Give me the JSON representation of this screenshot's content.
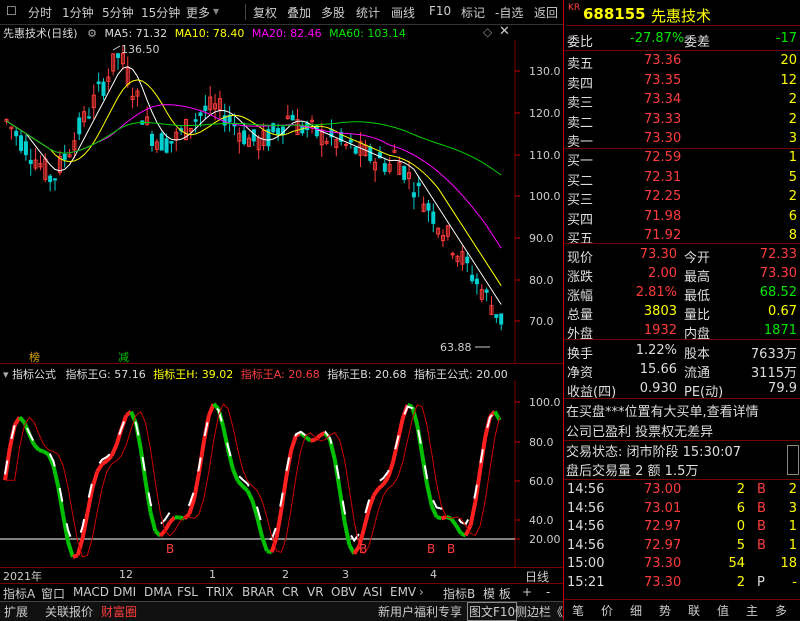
{
  "toolbar": {
    "items": [
      "分时",
      "1分钟",
      "5分钟",
      "15分钟",
      "更多",
      "复权",
      "叠加",
      "多股",
      "统计",
      "画线",
      "F10",
      "标记",
      "-自选",
      "返回"
    ]
  },
  "stock": {
    "market_badge": "KR",
    "code": "688155",
    "name": "先惠技术"
  },
  "main_chart": {
    "title": "先惠技术(日线)",
    "ma5": "MA5: 71.32",
    "ma10": "MA10: 78.40",
    "ma20": "MA20: 82.46",
    "ma60": "MA60: 103.14",
    "high_label": "136.50",
    "low_label": "63.88",
    "y_ticks": [
      "130.0",
      "120.0",
      "110.0",
      "100.0",
      "90.0",
      "80.0",
      "70.0"
    ],
    "tag_bang": "榜",
    "tag_jian": "减",
    "colors": {
      "up": "#ff3c3c",
      "down": "#00d0d0",
      "ma5": "#ffffff",
      "ma10": "#ffff00",
      "ma20": "#ff00ff",
      "ma60": "#00d000"
    }
  },
  "indicator": {
    "title": "指标公式",
    "g": "指标王G: 57.16",
    "h": "指标王H: 39.02",
    "a": "指标王A: 20.68",
    "b": "指标王B: 20.68",
    "formula": "指标王公式: 20.00",
    "y_ticks": [
      "100.0",
      "80.0",
      "60.0",
      "40.0",
      "20.00"
    ],
    "b_markers": [
      "B",
      "B",
      "B",
      "B"
    ]
  },
  "x_axis": {
    "labels": [
      "2021年",
      "12",
      "1",
      "2",
      "3",
      "4"
    ],
    "period": "日线"
  },
  "indicator_tabs": [
    "指标A",
    "窗口",
    "MACD",
    "DMI",
    "DMA",
    "FSL",
    "TRIX",
    "BRAR",
    "CR",
    "VR",
    "OBV",
    "ASI",
    "EMV",
    "指标B",
    "模 板"
  ],
  "tab_controls": [
    "+",
    "-"
  ],
  "bottom_tabs": [
    "扩展",
    "关联报价",
    "财富圈"
  ],
  "bottom_right_tabs": [
    "新用户福利专享",
    "图文F10",
    "侧边栏《"
  ],
  "quote": {
    "weibi_label": "委比",
    "weibi_value": "-27.87%",
    "weicha_label": "委差",
    "weicha_value": "-17",
    "asks": [
      {
        "label": "卖五",
        "price": "73.36",
        "vol": "20"
      },
      {
        "label": "卖四",
        "price": "73.35",
        "vol": "12"
      },
      {
        "label": "卖三",
        "price": "73.34",
        "vol": "2"
      },
      {
        "label": "卖二",
        "price": "73.33",
        "vol": "2"
      },
      {
        "label": "卖一",
        "price": "73.30",
        "vol": "3"
      }
    ],
    "bids": [
      {
        "label": "买一",
        "price": "72.59",
        "vol": "1"
      },
      {
        "label": "买二",
        "price": "72.31",
        "vol": "5"
      },
      {
        "label": "买三",
        "price": "72.25",
        "vol": "2"
      },
      {
        "label": "买四",
        "price": "71.98",
        "vol": "6"
      },
      {
        "label": "买五",
        "price": "71.92",
        "vol": "8"
      }
    ],
    "stats": [
      {
        "l1": "现价",
        "v1": "73.30",
        "l2": "今开",
        "v2": "72.33",
        "c1": "red",
        "c2": "red"
      },
      {
        "l1": "涨跌",
        "v1": "2.00",
        "l2": "最高",
        "v2": "73.30",
        "c1": "red",
        "c2": "red"
      },
      {
        "l1": "涨幅",
        "v1": "2.81%",
        "l2": "最低",
        "v2": "68.52",
        "c1": "red",
        "c2": "green"
      },
      {
        "l1": "总量",
        "v1": "3803",
        "l2": "量比",
        "v2": "0.67",
        "c1": "yellow",
        "c2": "yellow"
      },
      {
        "l1": "外盘",
        "v1": "1932",
        "l2": "内盘",
        "v2": "1871",
        "c1": "red",
        "c2": "green"
      }
    ],
    "stats2": [
      {
        "l1": "换手",
        "v1": "1.22%",
        "l2": "股本",
        "v2": "7633万"
      },
      {
        "l1": "净资",
        "v1": "15.66",
        "l2": "流通",
        "v2": "3115万"
      },
      {
        "l1": "收益(四)",
        "v1": "0.930",
        "l2": "PE(动)",
        "v2": "79.9"
      }
    ],
    "notice_line1": "在买盘***位置有大买单,查看详情",
    "notice_line2": "公司已盈利 投票权无差异",
    "trade_status": "交易状态: 闭市阶段 15:30:07",
    "after_hours": "盘后交易量 2 额 1.5万",
    "ticks": [
      {
        "time": "14:56",
        "price": "73.00",
        "vol": "2",
        "side": "B",
        "n": "2"
      },
      {
        "time": "14:56",
        "price": "73.01",
        "vol": "6",
        "side": "B",
        "n": "3"
      },
      {
        "time": "14:56",
        "price": "72.97",
        "vol": "0",
        "side": "B",
        "n": "1"
      },
      {
        "time": "14:56",
        "price": "72.97",
        "vol": "5",
        "side": "B",
        "n": "1"
      },
      {
        "time": "15:00",
        "price": "73.30",
        "vol": "54",
        "side": "",
        "n": "18"
      },
      {
        "time": "15:21",
        "price": "73.30",
        "vol": "2",
        "side": "P",
        "n": "-"
      }
    ],
    "side_tabs": [
      "笔",
      "价",
      "细",
      "势",
      "联",
      "值",
      "主",
      "多"
    ]
  }
}
